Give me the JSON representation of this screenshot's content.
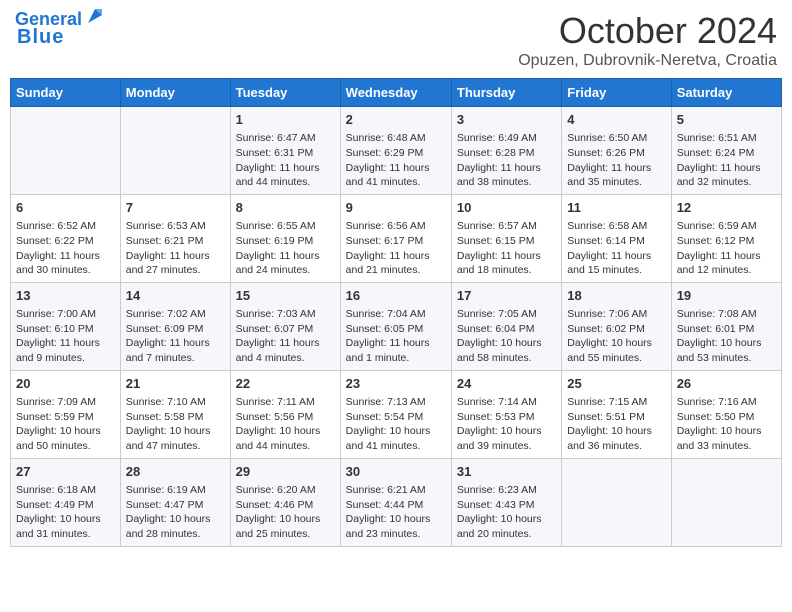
{
  "header": {
    "logo_line1": "General",
    "logo_line2": "Blue",
    "month": "October 2024",
    "location": "Opuzen, Dubrovnik-Neretva, Croatia"
  },
  "days_of_week": [
    "Sunday",
    "Monday",
    "Tuesday",
    "Wednesday",
    "Thursday",
    "Friday",
    "Saturday"
  ],
  "weeks": [
    [
      {
        "day": "",
        "content": ""
      },
      {
        "day": "",
        "content": ""
      },
      {
        "day": "1",
        "content": "Sunrise: 6:47 AM\nSunset: 6:31 PM\nDaylight: 11 hours and 44 minutes."
      },
      {
        "day": "2",
        "content": "Sunrise: 6:48 AM\nSunset: 6:29 PM\nDaylight: 11 hours and 41 minutes."
      },
      {
        "day": "3",
        "content": "Sunrise: 6:49 AM\nSunset: 6:28 PM\nDaylight: 11 hours and 38 minutes."
      },
      {
        "day": "4",
        "content": "Sunrise: 6:50 AM\nSunset: 6:26 PM\nDaylight: 11 hours and 35 minutes."
      },
      {
        "day": "5",
        "content": "Sunrise: 6:51 AM\nSunset: 6:24 PM\nDaylight: 11 hours and 32 minutes."
      }
    ],
    [
      {
        "day": "6",
        "content": "Sunrise: 6:52 AM\nSunset: 6:22 PM\nDaylight: 11 hours and 30 minutes."
      },
      {
        "day": "7",
        "content": "Sunrise: 6:53 AM\nSunset: 6:21 PM\nDaylight: 11 hours and 27 minutes."
      },
      {
        "day": "8",
        "content": "Sunrise: 6:55 AM\nSunset: 6:19 PM\nDaylight: 11 hours and 24 minutes."
      },
      {
        "day": "9",
        "content": "Sunrise: 6:56 AM\nSunset: 6:17 PM\nDaylight: 11 hours and 21 minutes."
      },
      {
        "day": "10",
        "content": "Sunrise: 6:57 AM\nSunset: 6:15 PM\nDaylight: 11 hours and 18 minutes."
      },
      {
        "day": "11",
        "content": "Sunrise: 6:58 AM\nSunset: 6:14 PM\nDaylight: 11 hours and 15 minutes."
      },
      {
        "day": "12",
        "content": "Sunrise: 6:59 AM\nSunset: 6:12 PM\nDaylight: 11 hours and 12 minutes."
      }
    ],
    [
      {
        "day": "13",
        "content": "Sunrise: 7:00 AM\nSunset: 6:10 PM\nDaylight: 11 hours and 9 minutes."
      },
      {
        "day": "14",
        "content": "Sunrise: 7:02 AM\nSunset: 6:09 PM\nDaylight: 11 hours and 7 minutes."
      },
      {
        "day": "15",
        "content": "Sunrise: 7:03 AM\nSunset: 6:07 PM\nDaylight: 11 hours and 4 minutes."
      },
      {
        "day": "16",
        "content": "Sunrise: 7:04 AM\nSunset: 6:05 PM\nDaylight: 11 hours and 1 minute."
      },
      {
        "day": "17",
        "content": "Sunrise: 7:05 AM\nSunset: 6:04 PM\nDaylight: 10 hours and 58 minutes."
      },
      {
        "day": "18",
        "content": "Sunrise: 7:06 AM\nSunset: 6:02 PM\nDaylight: 10 hours and 55 minutes."
      },
      {
        "day": "19",
        "content": "Sunrise: 7:08 AM\nSunset: 6:01 PM\nDaylight: 10 hours and 53 minutes."
      }
    ],
    [
      {
        "day": "20",
        "content": "Sunrise: 7:09 AM\nSunset: 5:59 PM\nDaylight: 10 hours and 50 minutes."
      },
      {
        "day": "21",
        "content": "Sunrise: 7:10 AM\nSunset: 5:58 PM\nDaylight: 10 hours and 47 minutes."
      },
      {
        "day": "22",
        "content": "Sunrise: 7:11 AM\nSunset: 5:56 PM\nDaylight: 10 hours and 44 minutes."
      },
      {
        "day": "23",
        "content": "Sunrise: 7:13 AM\nSunset: 5:54 PM\nDaylight: 10 hours and 41 minutes."
      },
      {
        "day": "24",
        "content": "Sunrise: 7:14 AM\nSunset: 5:53 PM\nDaylight: 10 hours and 39 minutes."
      },
      {
        "day": "25",
        "content": "Sunrise: 7:15 AM\nSunset: 5:51 PM\nDaylight: 10 hours and 36 minutes."
      },
      {
        "day": "26",
        "content": "Sunrise: 7:16 AM\nSunset: 5:50 PM\nDaylight: 10 hours and 33 minutes."
      }
    ],
    [
      {
        "day": "27",
        "content": "Sunrise: 6:18 AM\nSunset: 4:49 PM\nDaylight: 10 hours and 31 minutes."
      },
      {
        "day": "28",
        "content": "Sunrise: 6:19 AM\nSunset: 4:47 PM\nDaylight: 10 hours and 28 minutes."
      },
      {
        "day": "29",
        "content": "Sunrise: 6:20 AM\nSunset: 4:46 PM\nDaylight: 10 hours and 25 minutes."
      },
      {
        "day": "30",
        "content": "Sunrise: 6:21 AM\nSunset: 4:44 PM\nDaylight: 10 hours and 23 minutes."
      },
      {
        "day": "31",
        "content": "Sunrise: 6:23 AM\nSunset: 4:43 PM\nDaylight: 10 hours and 20 minutes."
      },
      {
        "day": "",
        "content": ""
      },
      {
        "day": "",
        "content": ""
      }
    ]
  ]
}
